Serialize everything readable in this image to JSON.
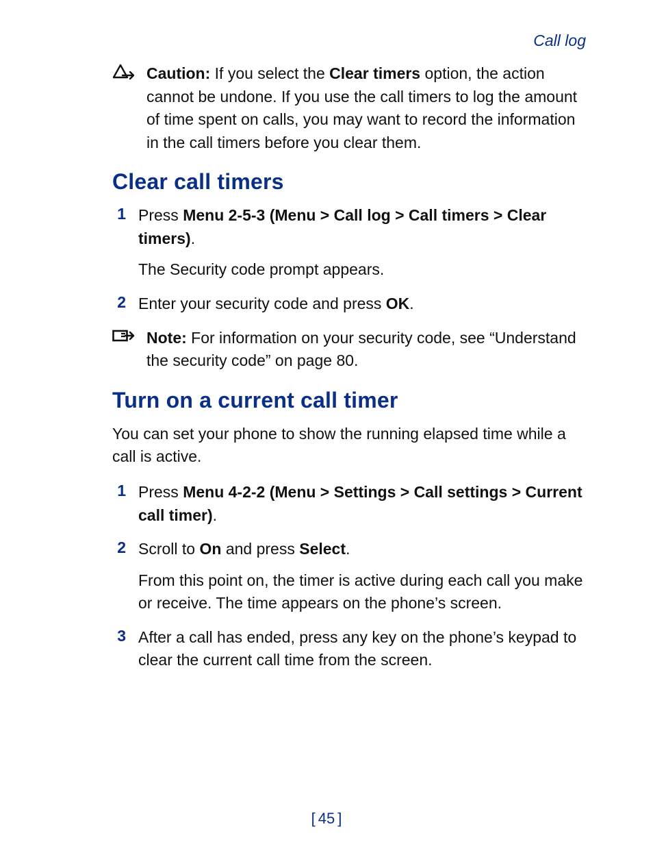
{
  "header": {
    "running_head": "Call log"
  },
  "caution": {
    "icon_name": "caution-icon",
    "label": "Caution:",
    "text_before_strong": " If you select the ",
    "strong": "Clear timers",
    "text_after_strong": " option, the action cannot be undone. If you use the call timers to log the amount of time spent on calls, you may want to record the information in the call timers before you clear them."
  },
  "section1": {
    "heading": "Clear call timers",
    "step1": {
      "num": "1",
      "pre": "Press ",
      "menu_path": "Menu 2-5-3 (Menu > Call log > Call timers > Clear timers)",
      "post": ".",
      "result": "The Security code prompt appears."
    },
    "step2": {
      "num": "2",
      "pre": "Enter your security code and press ",
      "key": "OK",
      "post": "."
    }
  },
  "note": {
    "icon_name": "note-icon",
    "label": "Note:",
    "text": "  For information on your security code, see “Understand the security code” on page 80."
  },
  "section2": {
    "heading": "Turn on a current call timer",
    "intro": "You can set your phone to show the running elapsed time while a call is active.",
    "step1": {
      "num": "1",
      "pre": "Press ",
      "menu_path": "Menu 4-2-2 (Menu > Settings > Call settings > Current call timer)",
      "post": "."
    },
    "step2": {
      "num": "2",
      "pre": "Scroll to ",
      "val": "On",
      "mid": " and press ",
      "key": "Select",
      "post": ".",
      "result": "From this point on, the timer is active during each call you make or receive. The time appears on the phone’s screen."
    },
    "step3": {
      "num": "3",
      "text": "After a call has ended, press any key on the phone’s keypad to clear the current call time from the screen."
    }
  },
  "footer": {
    "bracket_open": "[",
    "page": "45",
    "bracket_close": "]"
  }
}
